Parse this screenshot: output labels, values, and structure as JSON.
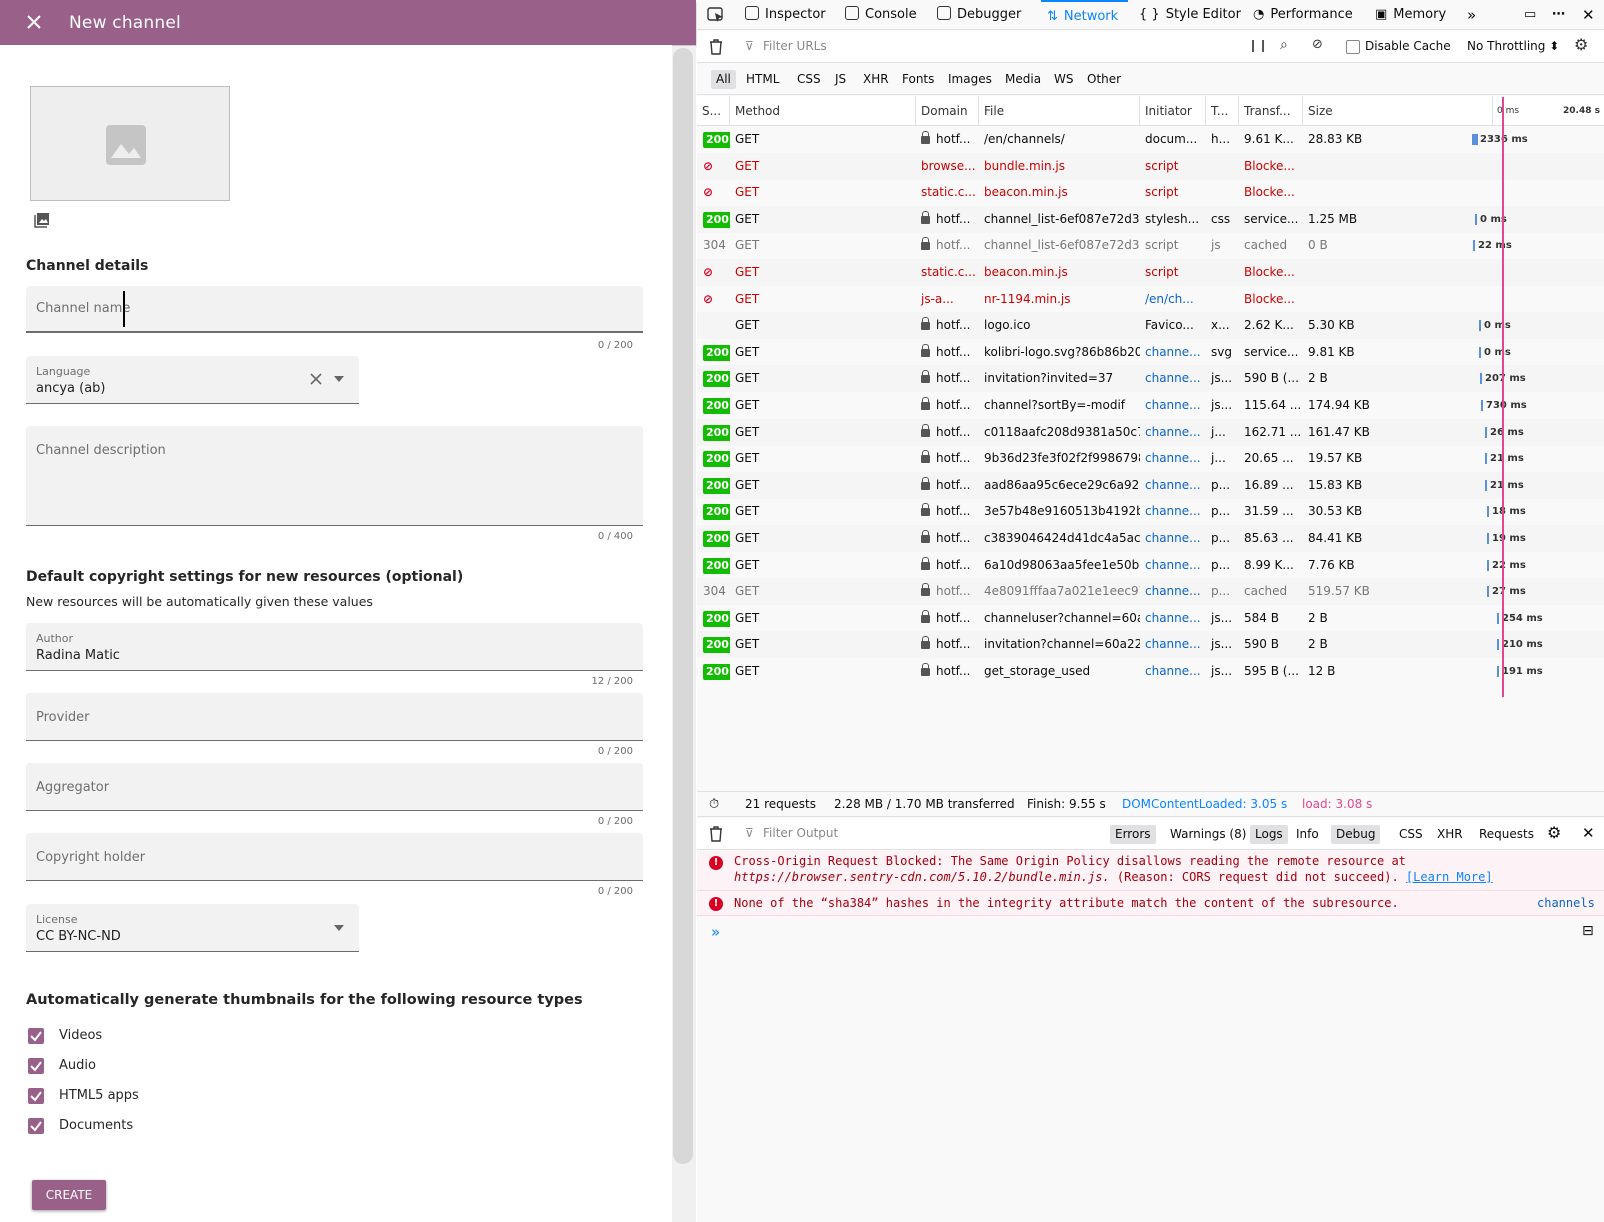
{
  "left": {
    "title": "New channel",
    "section_details": "Channel details",
    "channel_name_label": "Channel name",
    "channel_name_counter": "0 / 200",
    "language_label": "Language",
    "language_value": "ancya (ab)",
    "description_label": "Channel description",
    "description_counter": "0 / 400",
    "copyright_heading": "Default copyright settings for new resources (optional)",
    "copyright_sub": "New resources will be automatically given these values",
    "author_label": "Author",
    "author_value": "Radina Matic",
    "author_counter": "12 / 200",
    "provider_label": "Provider",
    "provider_counter": "0 / 200",
    "aggregator_label": "Aggregator",
    "aggregator_counter": "0 / 200",
    "holder_label": "Copyright holder",
    "holder_counter": "0 / 200",
    "license_label": "License",
    "license_value": "CC BY-NC-ND",
    "thumbs_heading": "Automatically generate thumbnails for the following resource types",
    "checkboxes": [
      "Videos",
      "Audio",
      "HTML5 apps",
      "Documents"
    ],
    "create_label": "CREATE",
    "accent": "#996189"
  },
  "devtools": {
    "tabs": [
      "Inspector",
      "Console",
      "Debugger",
      "Network",
      "Style Editor",
      "Performance",
      "Memory"
    ],
    "filter_placeholder": "Filter URLs",
    "disable_cache": "Disable Cache",
    "throttling": "No Throttling ⬍",
    "types": [
      "All",
      "HTML",
      "CSS",
      "JS",
      "XHR",
      "Fonts",
      "Images",
      "Media",
      "WS",
      "Other"
    ],
    "columns": [
      "S...",
      "Method",
      "Domain",
      "File",
      "Initiator",
      "T...",
      "Transf...",
      "Size"
    ],
    "timeline_start": "0 ms",
    "timeline_end": "20.48 s",
    "requests": [
      {
        "status": "200",
        "method": "GET",
        "domain": "hotf...",
        "file": "/en/channels/",
        "initiator": "docum...",
        "type": "h...",
        "transferred": "9.61 K...",
        "size": "28.83 KB",
        "timing": "2336 ms",
        "kind": "ok"
      },
      {
        "status": "blocked",
        "method": "GET",
        "domain": "browse...",
        "file": "bundle.min.js",
        "initiator": "script",
        "type": "",
        "transferred": "Blocke...",
        "size": "",
        "timing": "",
        "kind": "blocked"
      },
      {
        "status": "blocked",
        "method": "GET",
        "domain": "static.c...",
        "file": "beacon.min.js",
        "initiator": "script",
        "type": "",
        "transferred": "Blocke...",
        "size": "",
        "timing": "",
        "kind": "blocked"
      },
      {
        "status": "200",
        "method": "GET",
        "domain": "hotf...",
        "file": "channel_list-6ef087e72d3e",
        "initiator": "stylesh...",
        "type": "css",
        "transferred": "service...",
        "size": "1.25 MB",
        "timing": "0 ms",
        "kind": "ok"
      },
      {
        "status": "304",
        "method": "GET",
        "domain": "hotf...",
        "file": "channel_list-6ef087e72d3e",
        "initiator": "script",
        "type": "js",
        "transferred": "cached",
        "size": "0 B",
        "timing": "22 ms",
        "kind": "cached"
      },
      {
        "status": "blocked",
        "method": "GET",
        "domain": "static.c...",
        "file": "beacon.min.js",
        "initiator": "script",
        "type": "",
        "transferred": "Blocke...",
        "size": "",
        "timing": "",
        "kind": "blocked"
      },
      {
        "status": "blocked",
        "method": "GET",
        "domain": "js-a...",
        "file": "nr-1194.min.js",
        "initiator": "/en/ch...",
        "type": "",
        "transferred": "Blocke...",
        "size": "",
        "timing": "",
        "kind": "blocked"
      },
      {
        "status": "",
        "method": "GET",
        "domain": "hotf...",
        "file": "logo.ico",
        "initiator": "Favico...",
        "type": "x...",
        "transferred": "2.62 K...",
        "size": "5.30 KB",
        "timing": "0 ms",
        "kind": "ok"
      },
      {
        "status": "200",
        "method": "GET",
        "domain": "hotf...",
        "file": "kolibri-logo.svg?86b86b209",
        "initiator": "channe...",
        "type": "svg",
        "transferred": "service...",
        "size": "9.81 KB",
        "timing": "0 ms",
        "kind": "ok"
      },
      {
        "status": "200",
        "method": "GET",
        "domain": "hotf...",
        "file": "invitation?invited=37",
        "initiator": "channe...",
        "type": "js...",
        "transferred": "590 B (...",
        "size": "2 B",
        "timing": "207 ms",
        "kind": "ok"
      },
      {
        "status": "200",
        "method": "GET",
        "domain": "hotf...",
        "file": "channel?sortBy=-modif",
        "initiator": "channe...",
        "type": "js...",
        "transferred": "115.64 ...",
        "size": "174.94 KB",
        "timing": "730 ms",
        "kind": "ok"
      },
      {
        "status": "200",
        "method": "GET",
        "domain": "hotf...",
        "file": "c0118aafc208d9381a50c7b",
        "initiator": "channe...",
        "type": "j...",
        "transferred": "162.71 ...",
        "size": "161.47 KB",
        "timing": "26 ms",
        "kind": "ok"
      },
      {
        "status": "200",
        "method": "GET",
        "domain": "hotf...",
        "file": "9b36d23fe3f02f2f9986798",
        "initiator": "channe...",
        "type": "j...",
        "transferred": "20.65 ...",
        "size": "19.57 KB",
        "timing": "21 ms",
        "kind": "ok"
      },
      {
        "status": "200",
        "method": "GET",
        "domain": "hotf...",
        "file": "aad86aa95c6ece29c6a9250",
        "initiator": "channe...",
        "type": "p...",
        "transferred": "16.89 ...",
        "size": "15.83 KB",
        "timing": "21 ms",
        "kind": "ok"
      },
      {
        "status": "200",
        "method": "GET",
        "domain": "hotf...",
        "file": "3e57b48e9160513b4192b0",
        "initiator": "channe...",
        "type": "p...",
        "transferred": "31.59 ...",
        "size": "30.53 KB",
        "timing": "18 ms",
        "kind": "ok"
      },
      {
        "status": "200",
        "method": "GET",
        "domain": "hotf...",
        "file": "c3839046424d41dc4a5acec",
        "initiator": "channe...",
        "type": "p...",
        "transferred": "85.63 ...",
        "size": "84.41 KB",
        "timing": "19 ms",
        "kind": "ok"
      },
      {
        "status": "200",
        "method": "GET",
        "domain": "hotf...",
        "file": "6a10d98063aa5fee1e50b01",
        "initiator": "channe...",
        "type": "p...",
        "transferred": "8.99 K...",
        "size": "7.76 KB",
        "timing": "22 ms",
        "kind": "ok"
      },
      {
        "status": "304",
        "method": "GET",
        "domain": "hotf...",
        "file": "4e8091fffaa7a021e1eec97",
        "initiator": "channe...",
        "type": "p...",
        "transferred": "cached",
        "size": "519.57 KB",
        "timing": "27 ms",
        "kind": "cached"
      },
      {
        "status": "200",
        "method": "GET",
        "domain": "hotf...",
        "file": "channeluser?channel=60a22",
        "initiator": "channe...",
        "type": "js...",
        "transferred": "584 B",
        "size": "2 B",
        "timing": "254 ms",
        "kind": "ok"
      },
      {
        "status": "200",
        "method": "GET",
        "domain": "hotf...",
        "file": "invitation?channel=60a22cc",
        "initiator": "channe...",
        "type": "js...",
        "transferred": "590 B",
        "size": "2 B",
        "timing": "210 ms",
        "kind": "ok"
      },
      {
        "status": "200",
        "method": "GET",
        "domain": "hotf...",
        "file": "get_storage_used",
        "initiator": "channe...",
        "type": "js...",
        "transferred": "595 B (...",
        "size": "12 B",
        "timing": "191 ms",
        "kind": "ok"
      }
    ],
    "summary": {
      "requests": "21 requests",
      "transferred": "2.28 MB / 1.70 MB transferred",
      "finish": "Finish: 9.55 s",
      "dom": "DOMContentLoaded: 3.05 s",
      "load": "load: 3.08 s"
    },
    "console_filter_placeholder": "Filter Output",
    "console_filters": [
      "Errors",
      "Warnings (8)",
      "Logs",
      "Info",
      "Debug",
      "CSS",
      "XHR",
      "Requests"
    ],
    "messages": [
      {
        "line1": "Cross-Origin Request Blocked: The Same Origin Policy disallows reading the remote resource at",
        "line2": "https://browser.sentry-cdn.com/5.10.2/bundle.min.js.",
        "line2b": " (Reason: CORS request did not succeed).",
        "link": "[Learn More]"
      },
      {
        "line1": "None of the “sha384” hashes in the integrity attribute match the content of the subresource.",
        "source": "channels"
      }
    ]
  }
}
